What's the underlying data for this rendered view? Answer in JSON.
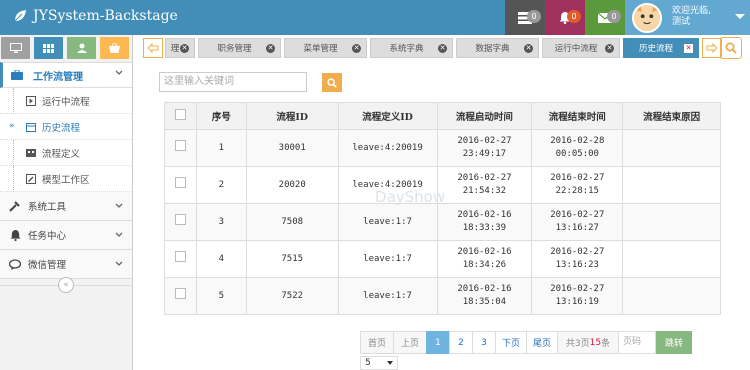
{
  "app": {
    "title": "JYSystem-Backstage"
  },
  "header": {
    "badges": {
      "tasks": "0",
      "notifications": "0",
      "messages": "0"
    },
    "user": {
      "welcome": "欢迎光临,",
      "name": "测试"
    }
  },
  "sidebar": {
    "active_group": "工作流管理",
    "subitems": [
      {
        "label": "运行中流程",
        "icon": "play-icon"
      },
      {
        "label": "历史流程",
        "icon": "calendar-icon"
      },
      {
        "label": "流程定义",
        "icon": "film-icon"
      },
      {
        "label": "模型工作区",
        "icon": "pencil-icon"
      }
    ],
    "groups": [
      {
        "label": "系统工具",
        "icon": "wrench-icon"
      },
      {
        "label": "任务中心",
        "icon": "bell-icon"
      },
      {
        "label": "微信管理",
        "icon": "chat-icon"
      }
    ]
  },
  "tabs": [
    {
      "label": "理"
    },
    {
      "label": "职务管理"
    },
    {
      "label": "菜单管理"
    },
    {
      "label": "系统字典"
    },
    {
      "label": "数据字典"
    },
    {
      "label": "运行中流程"
    },
    {
      "label": "历史流程"
    }
  ],
  "search": {
    "placeholder": "这里输入关键词"
  },
  "table": {
    "headers": [
      "序号",
      "流程ID",
      "流程定义ID",
      "流程启动时间",
      "流程结束时间",
      "流程结束原因"
    ],
    "rows": [
      {
        "no": "1",
        "id": "30001",
        "def": "leave:4:20019",
        "start_date": "2016-02-27",
        "start_time": "23:49:17",
        "end_date": "2016-02-28",
        "end_time": "00:05:00",
        "reason": ""
      },
      {
        "no": "2",
        "id": "20020",
        "def": "leave:4:20019",
        "start_date": "2016-02-27",
        "start_time": "21:54:32",
        "end_date": "2016-02-27",
        "end_time": "22:28:15",
        "reason": ""
      },
      {
        "no": "3",
        "id": "7508",
        "def": "leave:1:7",
        "start_date": "2016-02-16",
        "start_time": "18:33:39",
        "end_date": "2016-02-27",
        "end_time": "13:16:27",
        "reason": ""
      },
      {
        "no": "4",
        "id": "7515",
        "def": "leave:1:7",
        "start_date": "2016-02-16",
        "start_time": "18:34:26",
        "end_date": "2016-02-27",
        "end_time": "13:16:23",
        "reason": ""
      },
      {
        "no": "5",
        "id": "7522",
        "def": "leave:1:7",
        "start_date": "2016-02-16",
        "start_time": "18:35:04",
        "end_date": "2016-02-27",
        "end_time": "13:16:19",
        "reason": ""
      }
    ]
  },
  "watermark": "DayShow",
  "pager": {
    "first": "首页",
    "prev": "上页",
    "pages": [
      "1",
      "2",
      "3"
    ],
    "current": "1",
    "next": "下页",
    "last": "尾页",
    "summary_prefix": "共3页",
    "summary_count": "15",
    "summary_suffix": "条",
    "page_input_placeholder": "页码",
    "go": "跳转",
    "page_size": "5"
  }
}
